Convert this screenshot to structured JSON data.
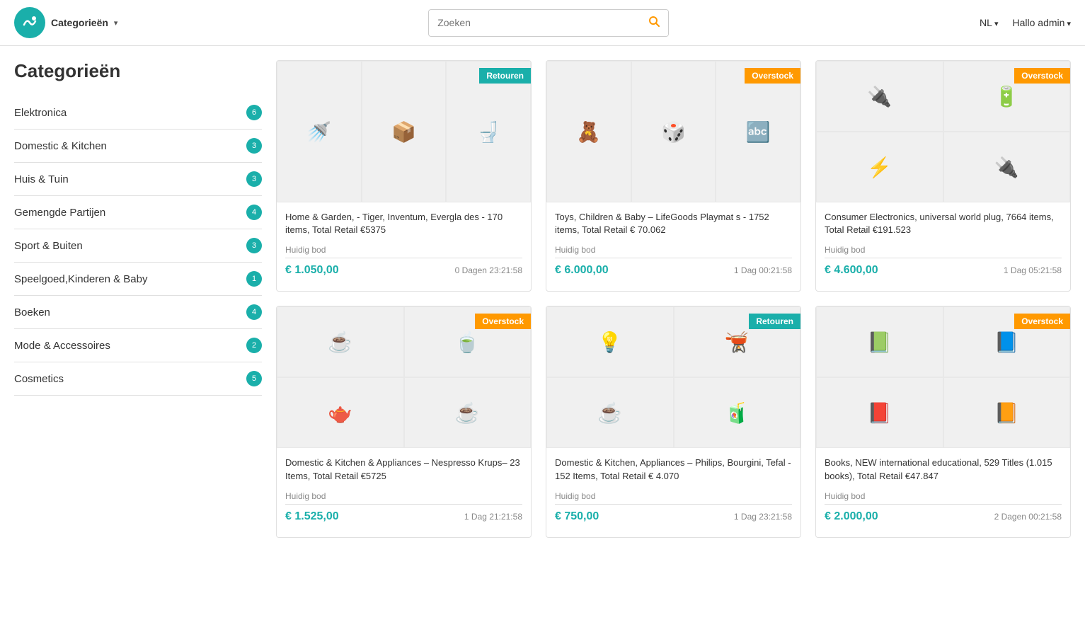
{
  "header": {
    "logo_icon": "😊",
    "categories_label": "Categorieën",
    "search_placeholder": "Zoeken",
    "lang_label": "NL",
    "user_label": "Hallo admin"
  },
  "sidebar": {
    "title": "Categorieën",
    "items": [
      {
        "id": "elektronica",
        "label": "Elektronica",
        "count": 6
      },
      {
        "id": "domestic-kitchen",
        "label": "Domestic & Kitchen",
        "count": 3
      },
      {
        "id": "huis-tuin",
        "label": "Huis & Tuin",
        "count": 3
      },
      {
        "id": "gemengde-partijen",
        "label": "Gemengde Partijen",
        "count": 4
      },
      {
        "id": "sport-buiten",
        "label": "Sport & Buiten",
        "count": 3
      },
      {
        "id": "speelgoed",
        "label": "Speelgoed,Kinderen & Baby",
        "count": 1
      },
      {
        "id": "boeken",
        "label": "Boeken",
        "count": 4
      },
      {
        "id": "mode-accessoires",
        "label": "Mode & Accessoires",
        "count": 2
      },
      {
        "id": "cosmetics",
        "label": "Cosmetics",
        "count": 5
      }
    ]
  },
  "products": [
    {
      "id": "p1",
      "badge": "Retouren",
      "badge_type": "retouren",
      "title": "Home & Garden, - Tiger, Inventum, Evergla des - 170 items, Total Retail €5375",
      "bid_label": "Huidig bod",
      "bid_price": "€ 1.050,00",
      "bid_time": "0 Dagen 23:21:58",
      "icons": [
        "🚿",
        "📦",
        "🚽"
      ]
    },
    {
      "id": "p2",
      "badge": "Overstock",
      "badge_type": "overstock",
      "title": "Toys, Children & Baby – LifeGoods Playmat s - 1752 items, Total Retail € 70.062",
      "bid_label": "Huidig bod",
      "bid_price": "€ 6.000,00",
      "bid_time": "1 Dag 00:21:58",
      "icons": [
        "🧸",
        "🎲",
        "🔤"
      ]
    },
    {
      "id": "p3",
      "badge": "Overstock",
      "badge_type": "overstock",
      "title": "Consumer Electronics, universal world plug, 7664 items, Total Retail €191.523",
      "bid_label": "Huidig bod",
      "bid_price": "€ 4.600,00",
      "bid_time": "1 Dag 05:21:58",
      "icons": [
        "🔌",
        "🔋",
        "⚡",
        "🔌"
      ]
    },
    {
      "id": "p4",
      "badge": "Overstock",
      "badge_type": "overstock",
      "title": "Domestic & Kitchen & Appliances – Nespresso Krups– 23 Items, Total Retail €5725",
      "bid_label": "Huidig bod",
      "bid_price": "€ 1.525,00",
      "bid_time": "1 Dag 21:21:58",
      "icons": [
        "☕",
        "🍵",
        "🫖",
        "☕"
      ]
    },
    {
      "id": "p5",
      "badge": "Retouren",
      "badge_type": "retouren",
      "title": "Domestic & Kitchen, Appliances – Philips, Bourgini, Tefal - 152 Items, Total Retail € 4.070",
      "bid_label": "Huidig bod",
      "bid_price": "€ 750,00",
      "bid_time": "1 Dag 23:21:58",
      "icons": [
        "💡",
        "🫕",
        "☕",
        "🧃"
      ]
    },
    {
      "id": "p6",
      "badge": "Overstock",
      "badge_type": "overstock",
      "title": "Books, NEW international educational, 529 Titles (1.015 books), Total Retail €47.847",
      "bid_label": "Huidig bod",
      "bid_price": "€ 2.000,00",
      "bid_time": "2 Dagen 00:21:58",
      "icons": [
        "📗",
        "📘",
        "📕",
        "📙"
      ]
    }
  ]
}
